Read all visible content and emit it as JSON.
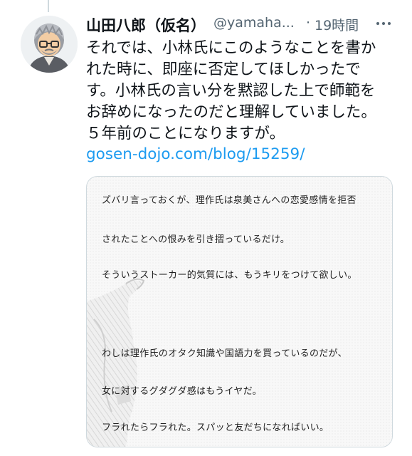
{
  "tweet": {
    "author_name": "山田八郎（仮名）",
    "author_handle": "@yamaha...",
    "separator": "·",
    "time": "19時間",
    "more_icon": "more-icon",
    "text_lines": [
      "それでは、小林氏にこのようなことを書か",
      "れた時に、即座に否定してほしかったで",
      "す。小林氏の言い分を黙認した上で師範を",
      "お辞めになったのだと理解していました。",
      "５年前のことになりますが。"
    ],
    "link": "gosen-dojo.com/blog/15259/"
  },
  "media": {
    "lines": [
      "ズバリ言っておくが、理作氏は泉美さんへの恋愛感情を拒否",
      "されたことへの恨みを引き摺っているだけ。",
      "そういうストーカー的気質には、もうキリをつけて欲しい。",
      "わしは理作氏のオタク知識や国語力を買っているのだが、",
      "女に対するグダグダ感はもうイヤだ。",
      "フラれたらフラれた。スパッと友だちになればいい。"
    ]
  },
  "colors": {
    "link": "#1d9bf0",
    "secondary_text": "#536471",
    "border": "#cfd9de"
  }
}
